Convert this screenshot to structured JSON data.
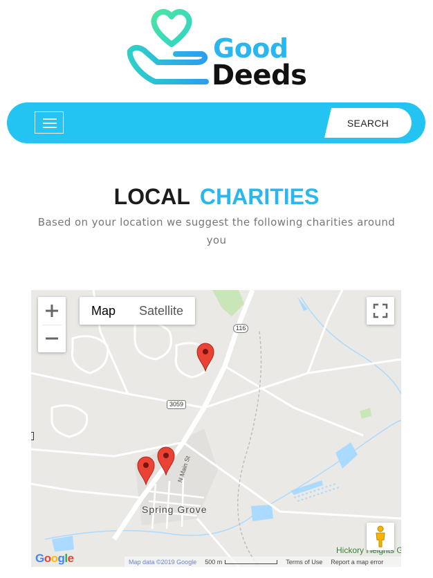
{
  "brand": {
    "name_line1": "Good",
    "name_line2": "Deeds",
    "logo_icon": "heart-in-hand-icon",
    "colors": {
      "accent_blue": "#2ab7ef",
      "nav_blue": "#24c4f2",
      "heart_green": "#3ee3a8",
      "dark_text": "#111111"
    }
  },
  "navbar": {
    "menu_icon": "hamburger-menu-icon",
    "search_label": "SEARCH"
  },
  "section": {
    "title_part1": "LOCAL",
    "title_part2": "CHARITIES",
    "subtitle": "Based on your location we suggest the following charities around you"
  },
  "map": {
    "zoom_in_label": "+",
    "zoom_out_label": "−",
    "map_type_options": [
      "Map",
      "Satellite"
    ],
    "selected_map_type": "Map",
    "fullscreen_icon": "fullscreen-icon",
    "pegman_icon": "street-view-pegman-icon",
    "marker_icon": "map-pin-icon",
    "marker_count": 3,
    "town_label": "Spring Grove",
    "poi_label": "Hickory Heights Golf Club",
    "street_label": "N Main St",
    "route_shields": [
      "116",
      "3059"
    ],
    "google_logo": "Google",
    "attribution": {
      "map_data": "Map data ©2019 Google",
      "scale": "500 m",
      "terms": "Terms of Use",
      "report": "Report a map error"
    }
  }
}
